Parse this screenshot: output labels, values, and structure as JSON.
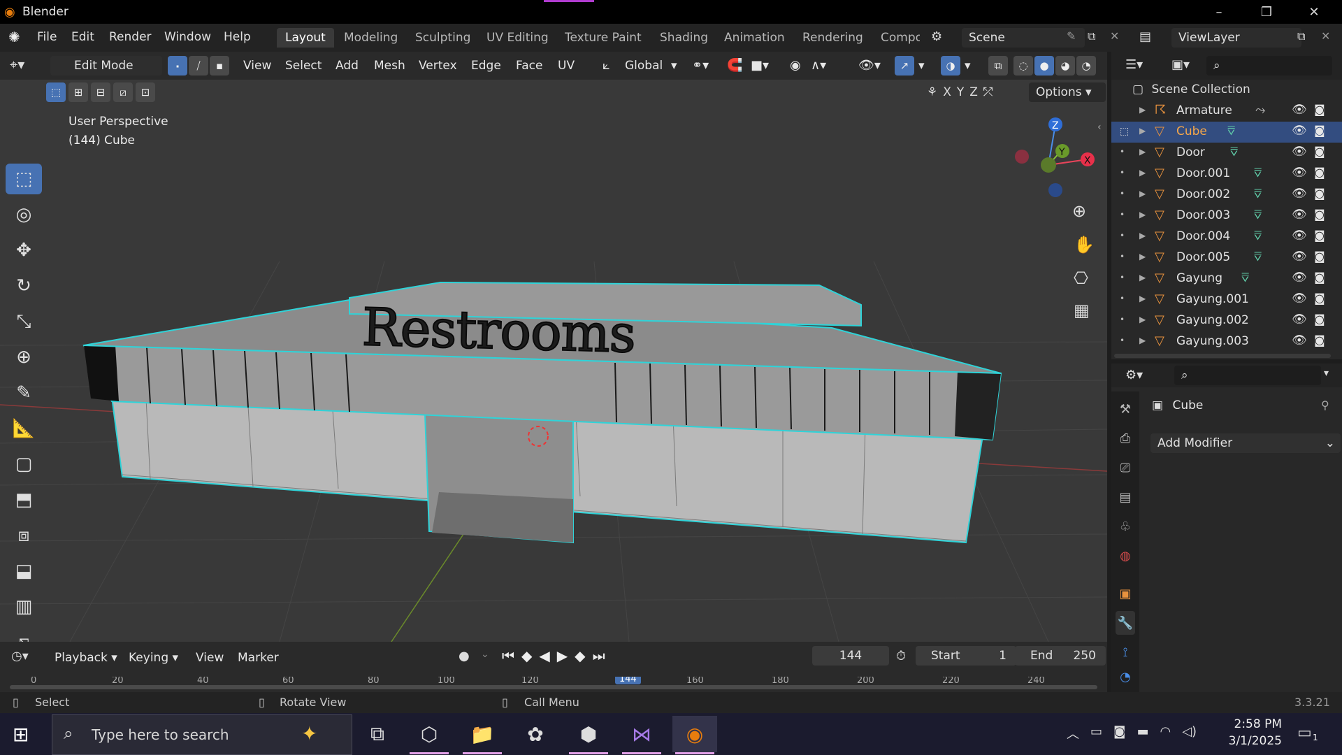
{
  "window": {
    "title": "Blender",
    "minimize": "–",
    "restore": "❐",
    "close": "✕"
  },
  "menu": {
    "items": [
      "File",
      "Edit",
      "Render",
      "Window",
      "Help"
    ]
  },
  "workspaces": {
    "tabs": [
      "Layout",
      "Modeling",
      "Sculpting",
      "UV Editing",
      "Texture Paint",
      "Shading",
      "Animation",
      "Rendering",
      "Compo"
    ],
    "active": "Layout"
  },
  "scene": {
    "label": "Scene",
    "viewlayer": "ViewLayer"
  },
  "viewport_header": {
    "mode": "Edit Mode",
    "menus": [
      "View",
      "Select",
      "Add",
      "Mesh",
      "Vertex",
      "Edge",
      "Face",
      "UV"
    ],
    "transform_orientation": "Global",
    "axes": [
      "X",
      "Y",
      "Z"
    ],
    "options_label": "Options"
  },
  "viewport": {
    "view_name": "User Perspective",
    "object_info": "(144) Cube",
    "sign_text": "Restrooms",
    "gizmo": {
      "z": "Z",
      "y": "Y",
      "x": "X"
    }
  },
  "outliner": {
    "collection": "Scene Collection",
    "items": [
      {
        "name": "Armature",
        "selected": false
      },
      {
        "name": "Cube",
        "selected": true
      },
      {
        "name": "Door",
        "selected": false
      },
      {
        "name": "Door.001",
        "selected": false
      },
      {
        "name": "Door.002",
        "selected": false
      },
      {
        "name": "Door.003",
        "selected": false
      },
      {
        "name": "Door.004",
        "selected": false
      },
      {
        "name": "Door.005",
        "selected": false
      },
      {
        "name": "Gayung",
        "selected": false
      },
      {
        "name": "Gayung.001",
        "selected": false
      },
      {
        "name": "Gayung.002",
        "selected": false
      },
      {
        "name": "Gayung.003",
        "selected": false
      }
    ]
  },
  "properties": {
    "object_name": "Cube",
    "add_modifier": "Add Modifier"
  },
  "timeline": {
    "menus": [
      "Playback",
      "Keying",
      "View",
      "Marker"
    ],
    "current_frame": "144",
    "start_label": "Start",
    "start": "1",
    "end_label": "End",
    "end": "250",
    "ruler": [
      "0",
      "20",
      "40",
      "60",
      "80",
      "100",
      "120",
      "144",
      "160",
      "180",
      "200",
      "220",
      "240"
    ]
  },
  "statusbar": {
    "select": "Select",
    "rotate": "Rotate View",
    "call_menu": "Call Menu",
    "version": "3.3.21"
  },
  "taskbar": {
    "search_placeholder": "Type here to search",
    "time": "2:58 PM",
    "date": "3/1/2025",
    "notifications": "1"
  }
}
